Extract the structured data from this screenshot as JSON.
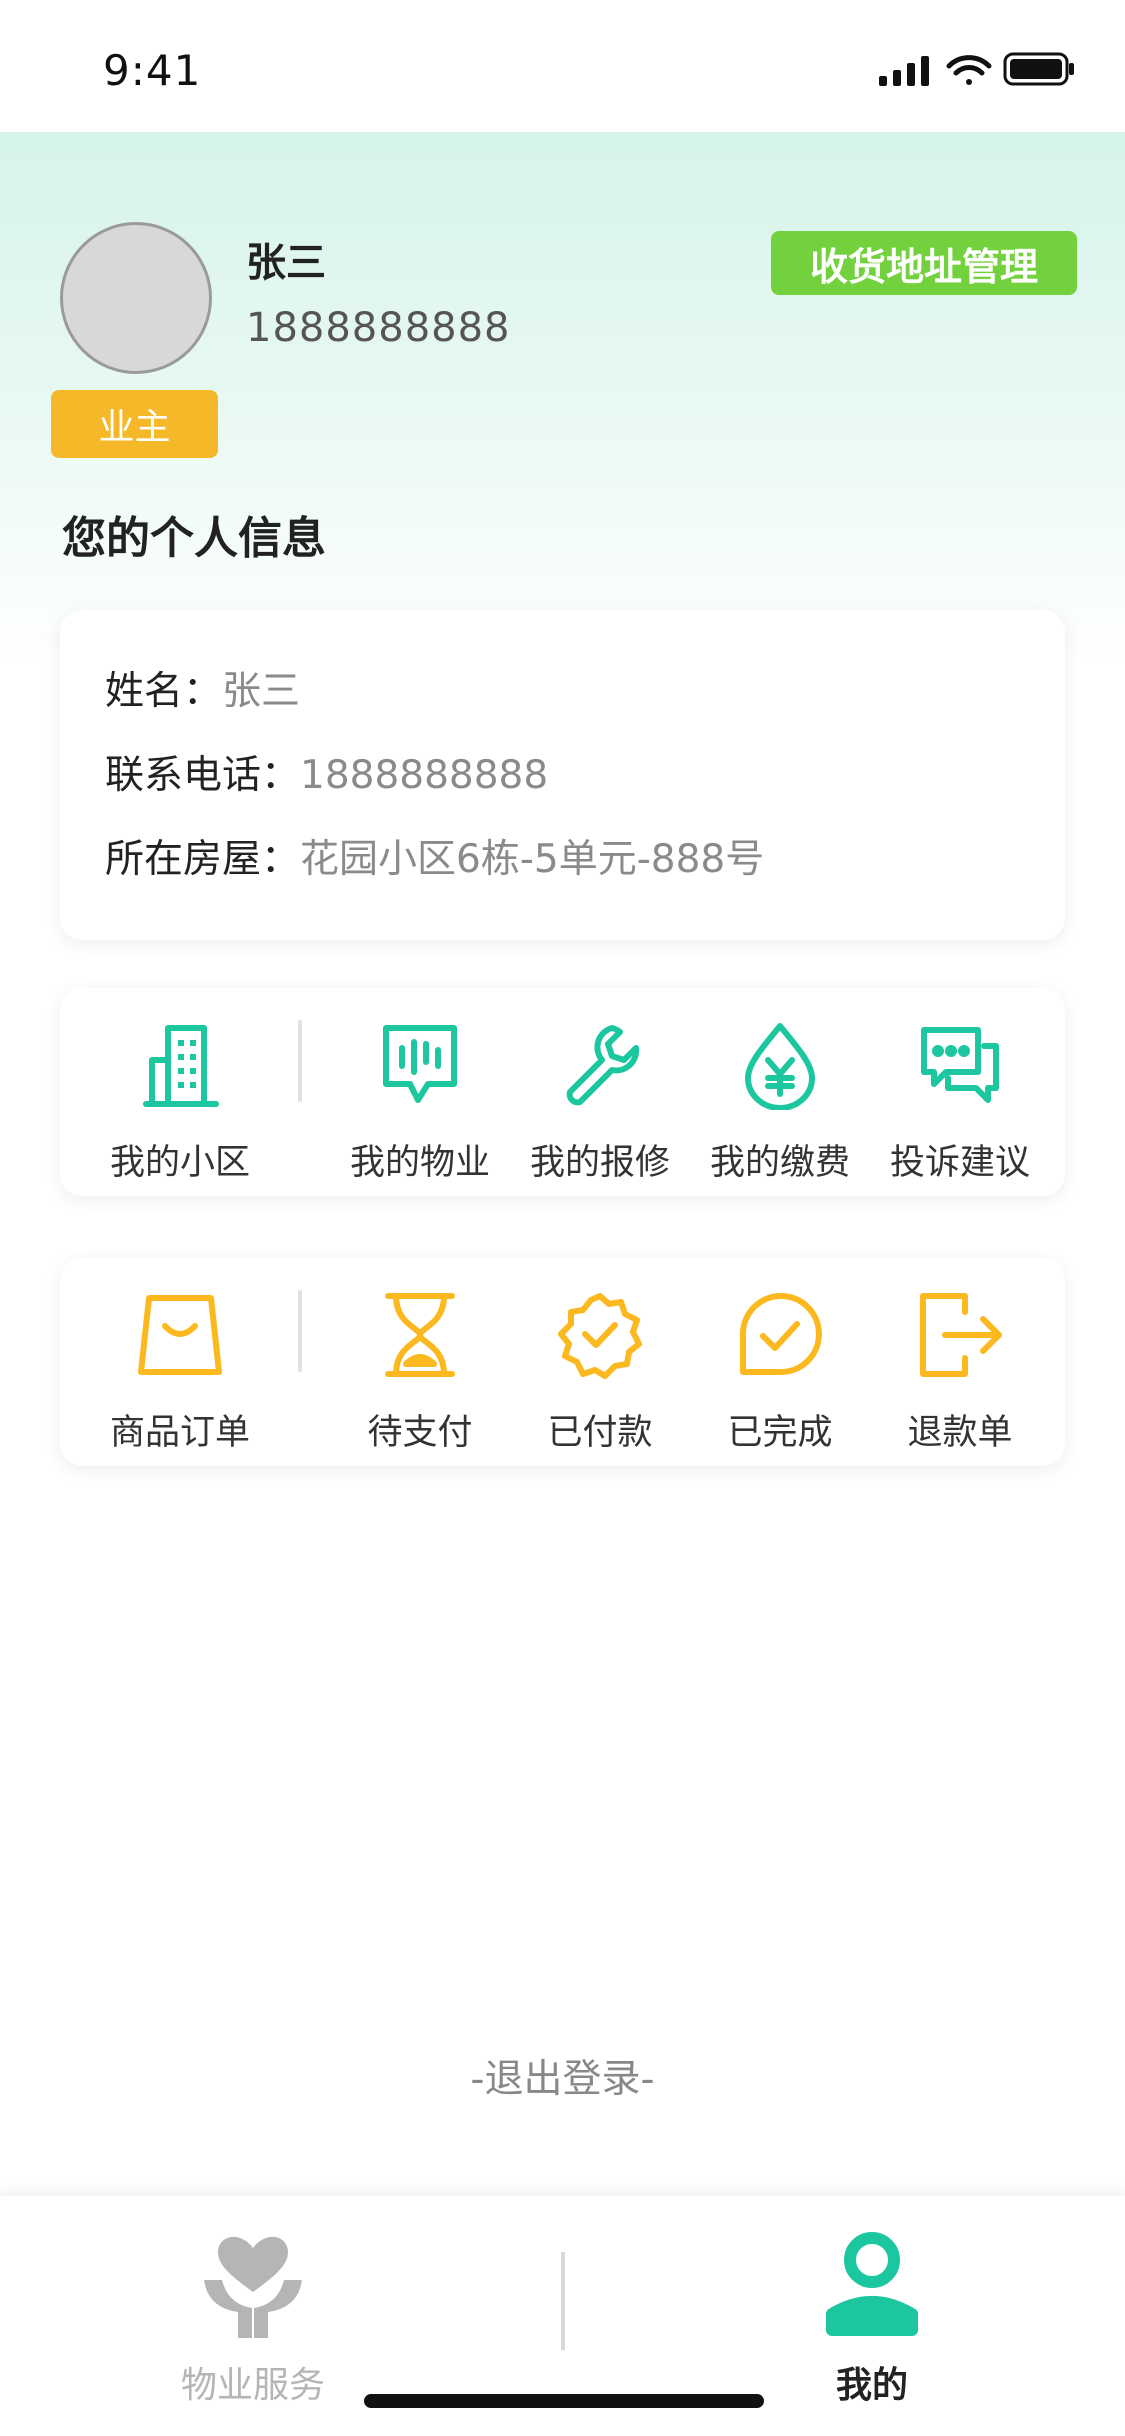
{
  "status_bar": {
    "time": "9:41"
  },
  "profile": {
    "name": "张三",
    "phone": "1888888888",
    "role_badge": "业主",
    "address_button": "收货地址管理",
    "section_title": "您的个人信息"
  },
  "info": {
    "rows": [
      {
        "label": "姓名：",
        "value": "张三"
      },
      {
        "label": "联系电话：",
        "value": "1888888888"
      },
      {
        "label": "所在房屋：",
        "value": "花园小区6栋-5单元-888号"
      }
    ]
  },
  "services": {
    "accent_color": "#1cc7a0",
    "items": [
      {
        "label": "我的小区",
        "icon": "building-icon"
      },
      {
        "label": "我的物业",
        "icon": "chat-bars-icon"
      },
      {
        "label": "我的报修",
        "icon": "wrench-icon"
      },
      {
        "label": "我的缴费",
        "icon": "yuan-drop-icon"
      },
      {
        "label": "投诉建议",
        "icon": "chat-bubbles-icon"
      }
    ]
  },
  "orders": {
    "accent_color": "#fbb81f",
    "items": [
      {
        "label": "商品订单",
        "icon": "shopping-bag-icon"
      },
      {
        "label": "待支付",
        "icon": "hourglass-icon"
      },
      {
        "label": "已付款",
        "icon": "badge-check-icon"
      },
      {
        "label": "已完成",
        "icon": "bubble-check-icon"
      },
      {
        "label": "退款单",
        "icon": "exit-arrow-icon"
      }
    ]
  },
  "logout_label": "-退出登录-",
  "tab_bar": {
    "items": [
      {
        "label": "物业服务",
        "icon": "heart-hands-icon",
        "active": false
      },
      {
        "label": "我的",
        "icon": "person-icon",
        "active": true
      }
    ],
    "active_color": "#1cc7a0",
    "inactive_color": "#b5b5b5"
  }
}
